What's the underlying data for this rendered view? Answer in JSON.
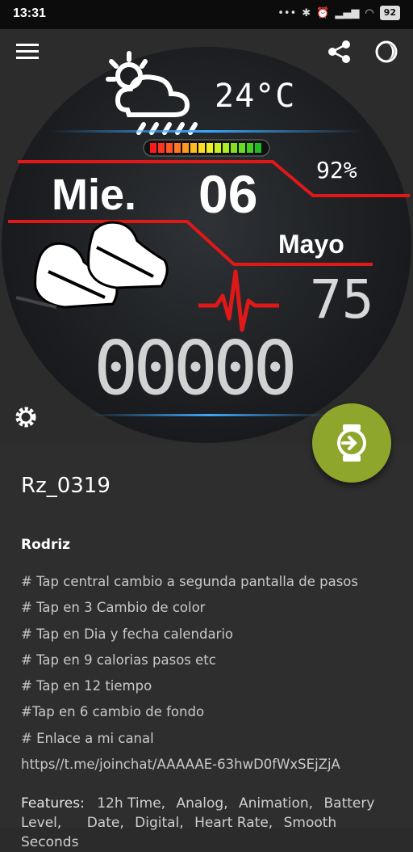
{
  "status_bar": {
    "time": "13:31",
    "icons": [
      "more-dots",
      "bluetooth",
      "alarm",
      "signal",
      "wifi"
    ],
    "battery": "92"
  },
  "preview": {
    "weather_icon": "cloud-sun-rain-icon",
    "temperature": "24°C",
    "battery_pct": "92%",
    "day": "Mie.",
    "date": "06",
    "month": "Mayo",
    "heart_rate": "75",
    "steps": "00000",
    "level_bar_segments": 14,
    "colors": {
      "accent_red": "#e01818",
      "glow_blue": "#3aa7ff",
      "fab_green": "#8ea62b"
    }
  },
  "app": {
    "title": "Rz_0319",
    "author": "Rodriz",
    "description": [
      "# Tap central cambio a segunda pantalla de pasos",
      "# Tap en 3 Cambio de color",
      "# Tap en Dia y fecha calendario",
      "# Tap en 9 calorias pasos etc",
      "# Tap en 12 tiempo",
      "#Tap en 6 cambio de fondo",
      "# Enlace a mi canal",
      "https//t.me/joinchat/AAAAAE-63hwD0fWxSEjZjA"
    ],
    "features_label": "Features:",
    "features": [
      "12h Time,",
      "Analog,",
      "Animation,",
      "Battery Level,",
      "Date,",
      "Digital,",
      "Heart Rate,",
      "Smooth Seconds"
    ]
  }
}
